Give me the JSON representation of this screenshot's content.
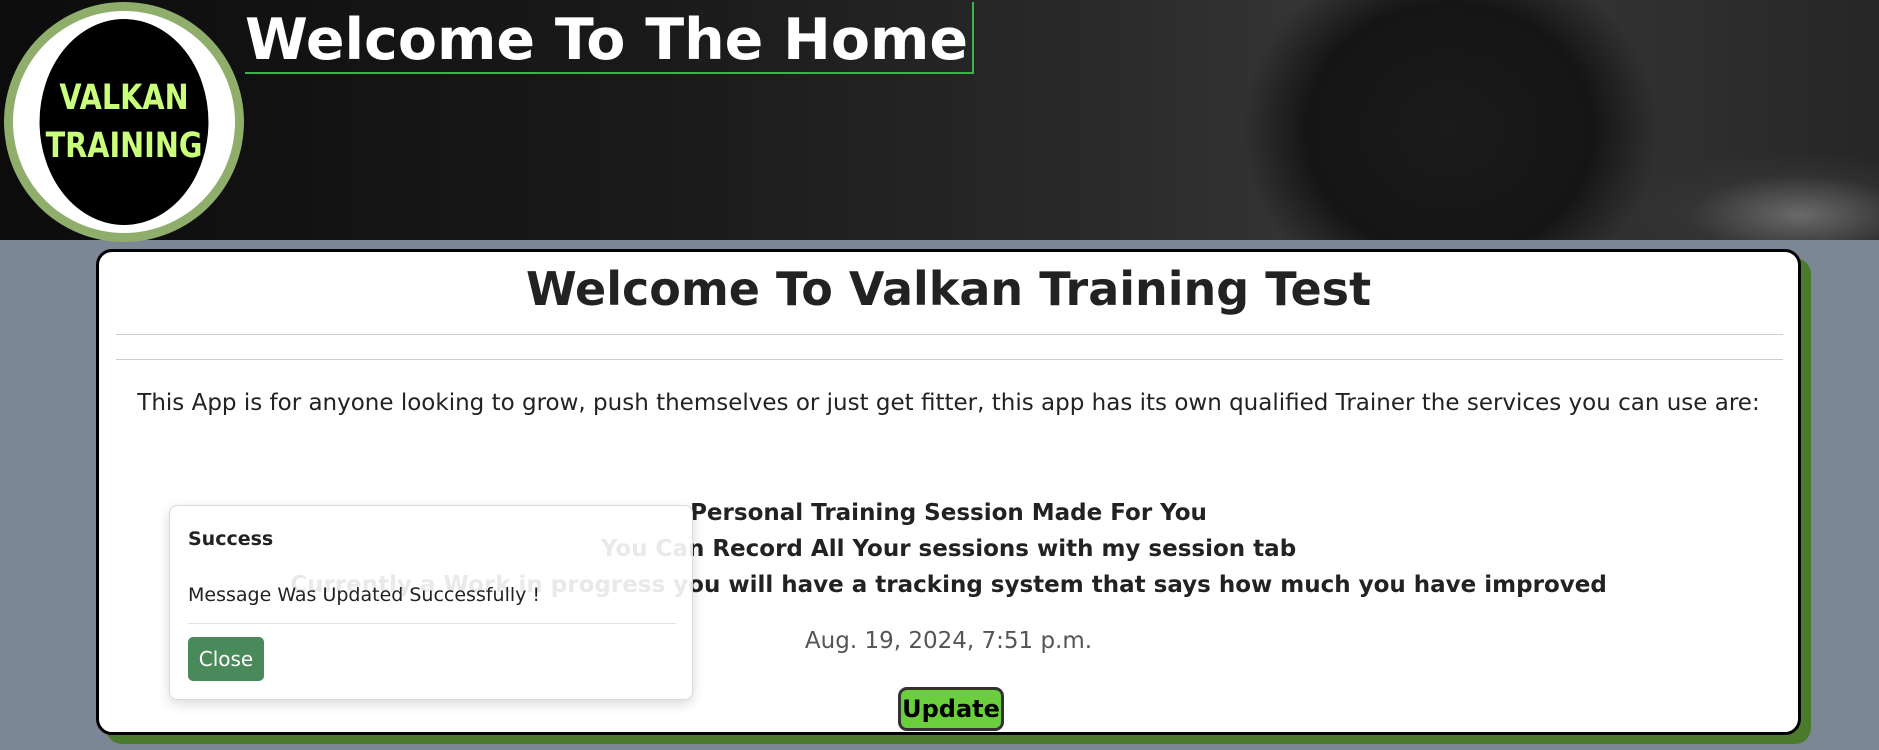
{
  "header": {
    "logo_line1": "VALKAN",
    "logo_line2": "TRAINING",
    "title": "Welcome To The Home"
  },
  "main": {
    "title": "Welcome To Valkan Training Test",
    "intro": "This App is for anyone looking to grow, push themselves or just get fitter, this app has its own qualified Trainer the services you can use are:",
    "features": [
      "Personal Training Session Made For You",
      "You Can Record All Your sessions with my session tab",
      "Currently a Work in progress you will have a tracking system that says how much you have improved"
    ],
    "timestamp": "Aug. 19, 2024, 7:51 p.m.",
    "update_label": "Update"
  },
  "toast": {
    "title": "Success",
    "message": "Message Was Updated Successfully !",
    "close_label": "Close"
  },
  "colors": {
    "accent_green": "#6bcf3d",
    "logo_text": "#c9ff7a",
    "close_button": "#4a8a5a",
    "card_shadow": "#4a7a2c"
  }
}
